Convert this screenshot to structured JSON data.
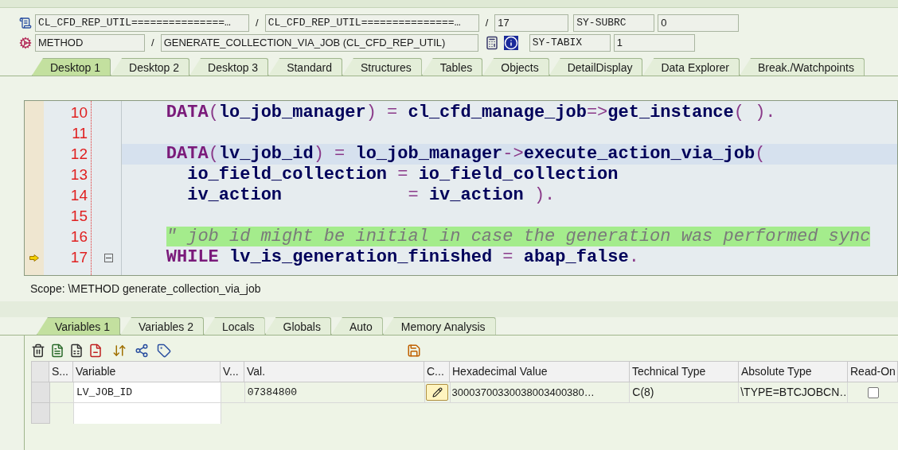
{
  "header": {
    "rows": [
      {
        "fields": [
          {
            "value": "CL_CFD_REP_UTIL===============…"
          },
          {
            "value": "CL_CFD_REP_UTIL===============…"
          },
          {
            "value": "17"
          }
        ],
        "name_field": {
          "value": "SY-SUBRC"
        },
        "value_field": {
          "value": "0"
        },
        "separators": [
          "/",
          "/"
        ]
      },
      {
        "fields": [
          {
            "value": "METHOD"
          },
          {
            "value": "GENERATE_COLLECTION_VIA_JOB (CL_CFD_REP_UTIL)"
          }
        ],
        "name_field": {
          "value": "SY-TABIX"
        },
        "value_field": {
          "value": "1"
        },
        "separators": [
          "/"
        ]
      }
    ]
  },
  "desktop_tabs": [
    {
      "label": "Desktop 1",
      "selected": true
    },
    {
      "label": "Desktop 2",
      "selected": false
    },
    {
      "label": "Desktop 3",
      "selected": false
    },
    {
      "label": "Standard",
      "selected": false
    },
    {
      "label": "Structures",
      "selected": false
    },
    {
      "label": "Tables",
      "selected": false
    },
    {
      "label": "Objects",
      "selected": false
    },
    {
      "label": "DetailDisplay",
      "selected": false
    },
    {
      "label": "Data Explorer",
      "selected": false
    },
    {
      "label": "Break./Watchpoints",
      "selected": false
    }
  ],
  "editor": {
    "lines": [
      {
        "number": "10",
        "current": false,
        "cursor_line": false,
        "foldable": false,
        "tokens": [
          {
            "kind": "kw",
            "text": "    DATA"
          },
          {
            "kind": "op",
            "text": "("
          },
          {
            "kind": "id",
            "text": "lo_job_manager"
          },
          {
            "kind": "op",
            "text": ") = "
          },
          {
            "kind": "id",
            "text": "cl_cfd_manage_job"
          },
          {
            "kind": "op",
            "text": "=>"
          },
          {
            "kind": "id",
            "text": "get_instance"
          },
          {
            "kind": "op",
            "text": "( )."
          }
        ]
      },
      {
        "number": "11",
        "current": false,
        "cursor_line": false,
        "foldable": false
      },
      {
        "number": "12",
        "current": false,
        "cursor_line": true,
        "foldable": false,
        "tokens": [
          {
            "kind": "kw",
            "text": "    DATA"
          },
          {
            "kind": "op",
            "text": "("
          },
          {
            "kind": "id",
            "text": "lv_job_id"
          },
          {
            "kind": "op",
            "text": ") = "
          },
          {
            "kind": "id",
            "text": "lo_job_manager"
          },
          {
            "kind": "op",
            "text": "->"
          },
          {
            "kind": "id",
            "text": "execute_action_via_job"
          },
          {
            "kind": "op",
            "text": "("
          }
        ]
      },
      {
        "number": "13",
        "current": false,
        "cursor_line": false,
        "foldable": false,
        "tokens": [
          {
            "kind": "id",
            "text": "      io_field_collection"
          },
          {
            "kind": "op",
            "text": " = "
          },
          {
            "kind": "id",
            "text": "io_field_collection"
          }
        ]
      },
      {
        "number": "14",
        "current": false,
        "cursor_line": false,
        "foldable": false,
        "tokens": [
          {
            "kind": "id",
            "text": "      iv_action"
          },
          {
            "kind": "op",
            "text": "            = "
          },
          {
            "kind": "id",
            "text": "iv_action"
          },
          {
            "kind": "op",
            "text": " )."
          }
        ]
      },
      {
        "number": "15",
        "current": false,
        "cursor_line": false,
        "foldable": false
      },
      {
        "number": "16",
        "current": false,
        "cursor_line": false,
        "foldable": false,
        "tokens": [
          {
            "kind": "comment",
            "text": "\" job id might be initial in case the generation was performed sync"
          }
        ]
      },
      {
        "number": "17",
        "current": true,
        "cursor_line": false,
        "foldable": true,
        "tokens": [
          {
            "kind": "kw",
            "text": "    WHILE"
          },
          {
            "kind": "id",
            "text": " lv_is_generation_finished"
          },
          {
            "kind": "op",
            "text": " = "
          },
          {
            "kind": "id",
            "text": "abap_false"
          },
          {
            "kind": "op",
            "text": "."
          }
        ]
      }
    ]
  },
  "scope": "Scope: \\METHOD generate_collection_via_job",
  "variable_tabs": [
    {
      "label": "Variables 1",
      "selected": true
    },
    {
      "label": "Variables 2",
      "selected": false
    },
    {
      "label": "Locals",
      "selected": false
    },
    {
      "label": "Globals",
      "selected": false
    },
    {
      "label": "Auto",
      "selected": false
    },
    {
      "label": "Memory Analysis",
      "selected": false
    }
  ],
  "table": {
    "columns": [
      "S...",
      "Variable",
      "V...",
      "Val.",
      "C...",
      "Hexadecimal Value",
      "Technical Type",
      "Absolute Type",
      "Read-On"
    ],
    "rows": [
      {
        "variable": "LV_JOB_ID",
        "value": "07384800",
        "hex": "30003700330038003400380…",
        "technical_type": "C(8)",
        "absolute_type": "\\TYPE=BTCJOBCN…",
        "read_only": false
      }
    ]
  }
}
